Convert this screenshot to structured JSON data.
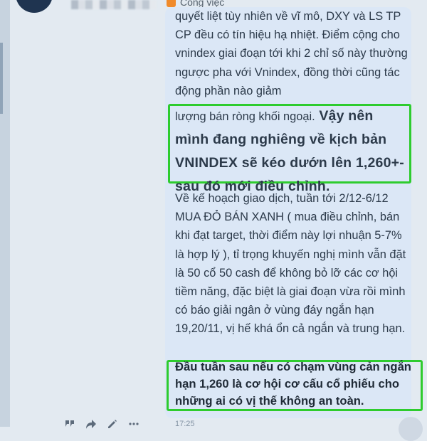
{
  "header": {
    "job_label": "Công việc"
  },
  "message": {
    "para1": "quyết liệt tùy nhiên về vĩ mô, DXY và LS TP CP đều có tín hiệu hạ nhiệt. Điểm cộng cho vnindex giai đoạn tới khi 2 chỉ số này thường ngược pha với Vnindex, đồng thời cũng tác động phần nào giảm",
    "para2_normal": "lượng bán ròng khối ngoại.",
    "para2_bold": " Vậy nên mình đang nghiêng về kịch bản VNINDEX sẽ kéo dướn lên 1,260+- sau đó mới điều chỉnh.",
    "para3": "Về kế hoạch giao dịch, tuần tới 2/12-6/12 MUA ĐỎ BÁN XANH ( mua điều chỉnh, bán khi đạt target, thời điểm này lợi nhuận 5-7% là hợp lý ), tỉ trọng khuyến nghị mình vẫn đặt là 50 cổ 50 cash để không bỏ lỡ các cơ hội tiềm năng, đặc biệt là giai đoạn vừa rồi mình có báo giải ngân ở vùng đáy ngắn hạn 19,20/11, vị hế khá ổn cả ngắn và trung hạn.",
    "para4": "Đầu tuần sau nếu có chạm vùng cản ngắn hạn 1,260 là cơ hội cơ cấu cổ phiếu cho những ai có vị thế không an toàn.",
    "time": "17:25"
  },
  "icons": {
    "accent_green": "#2ecc2e",
    "bubble_bg": "#dbe7f6"
  }
}
